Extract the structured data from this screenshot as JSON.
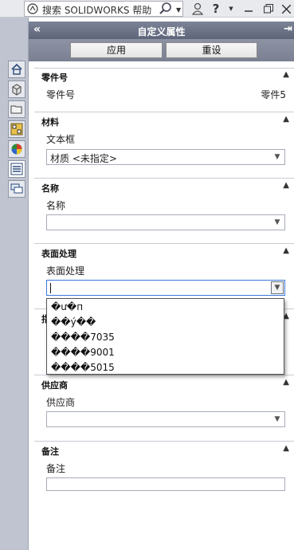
{
  "search": {
    "placeholder": "搜索 SOLIDWORKS 帮助"
  },
  "panel": {
    "title": "自定义属性",
    "collapse_glyph": "«",
    "pin_glyph": "⇥",
    "apply_label": "应用",
    "reset_label": "重设"
  },
  "sections": {
    "part_number": {
      "title": "零件号",
      "label": "零件号",
      "value": "零件5"
    },
    "material": {
      "title": "材料",
      "label": "文本框",
      "value": "材质 <未指定>"
    },
    "name": {
      "title": "名称",
      "label": "名称",
      "value": ""
    },
    "finish": {
      "title": "表面处理",
      "label": "表面处理",
      "value": ""
    },
    "hidden": {
      "title": "指"
    },
    "supplier": {
      "title": "供应商",
      "label": "供应商",
      "value": ""
    },
    "notes": {
      "title": "备注",
      "label": "备注",
      "value": ""
    }
  },
  "dropdown": {
    "options": [
      "�ư�п",
      "��ý��",
      "����7035",
      "����9001",
      "����5015"
    ]
  },
  "icons": {
    "left_tabs": [
      "home-icon",
      "part-icon",
      "folder-icon",
      "display-icon",
      "appearance-icon",
      "custom-properties-icon",
      "comments-icon"
    ],
    "toolbar": [
      "user-icon",
      "help-icon",
      "minimize-icon",
      "restore-icon",
      "close-icon"
    ]
  }
}
